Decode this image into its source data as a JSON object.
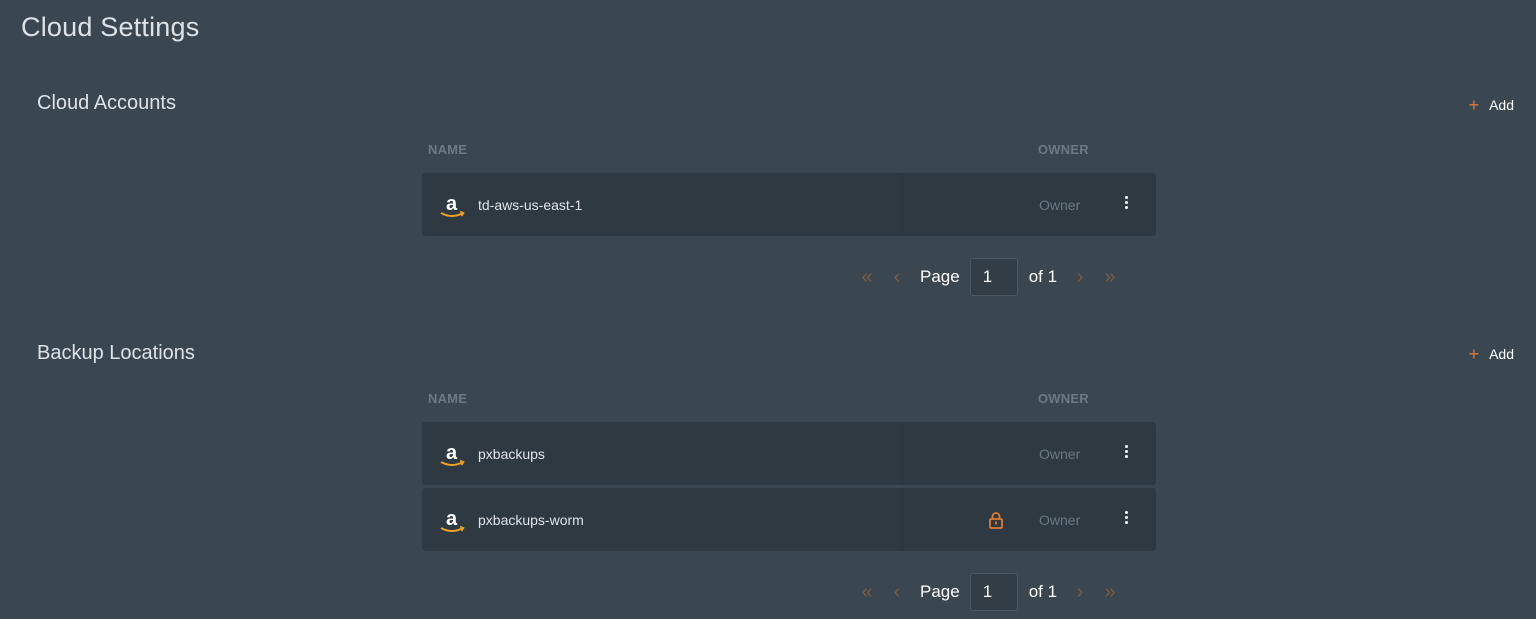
{
  "page": {
    "title": "Cloud Settings"
  },
  "icons": {
    "provider": "amazon-icon",
    "lock": "lock-icon",
    "menu": "kebab-menu-icon",
    "add": "plus-icon"
  },
  "colors": {
    "accent": "#e07a35",
    "background": "#3a4650",
    "row": "#2f3941"
  },
  "cloud_accounts": {
    "title": "Cloud Accounts",
    "add_label": "Add",
    "columns": {
      "name": "NAME",
      "owner": "OWNER"
    },
    "rows": [
      {
        "name": "td-aws-us-east-1",
        "owner": "Owner",
        "locked": false
      }
    ],
    "pager": {
      "page_label": "Page",
      "page_value": "1",
      "of_label": "of 1",
      "first": "«",
      "prev": "‹",
      "next": "›",
      "last": "»"
    }
  },
  "backup_locations": {
    "title": "Backup Locations",
    "add_label": "Add",
    "columns": {
      "name": "NAME",
      "owner": "OWNER"
    },
    "rows": [
      {
        "name": "pxbackups",
        "owner": "Owner",
        "locked": false
      },
      {
        "name": "pxbackups-worm",
        "owner": "Owner",
        "locked": true
      }
    ],
    "pager": {
      "page_label": "Page",
      "page_value": "1",
      "of_label": "of 1",
      "first": "«",
      "prev": "‹",
      "next": "›",
      "last": "»"
    }
  }
}
